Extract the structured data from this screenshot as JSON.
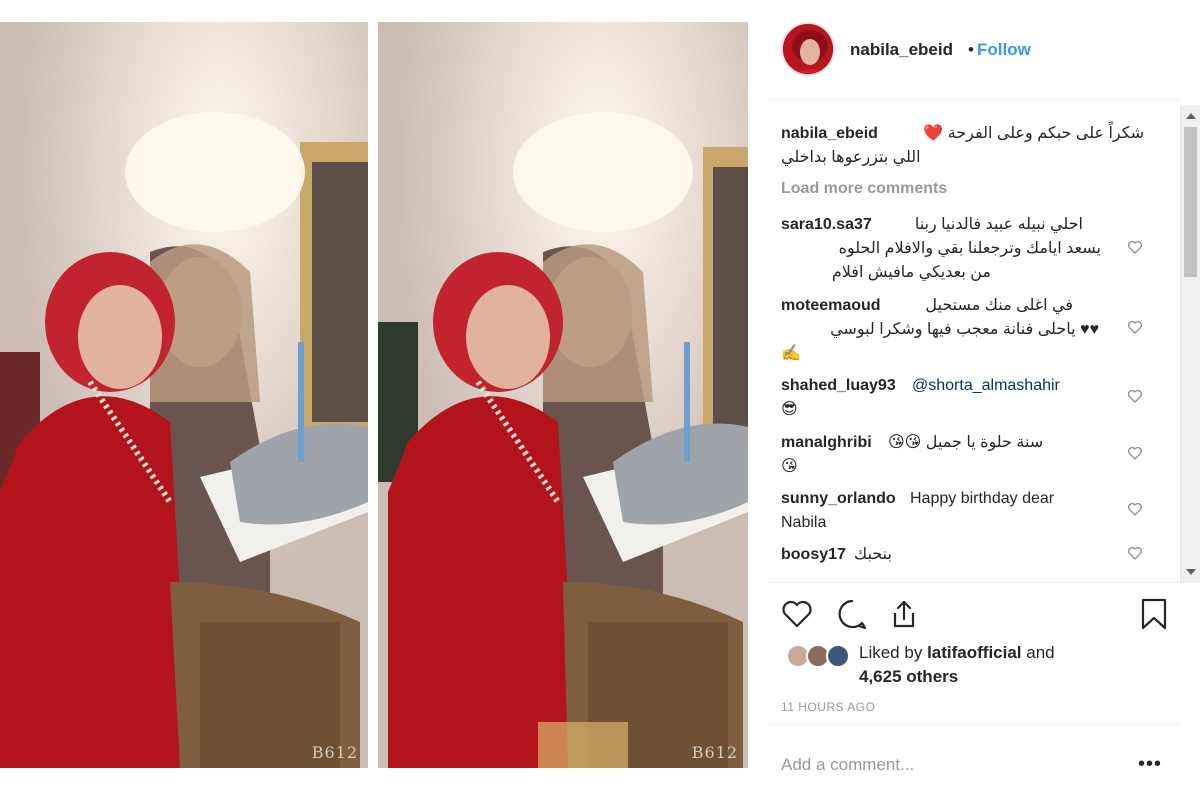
{
  "post": {
    "username": "nabila_ebeid",
    "separator": "•",
    "follow_label": "Follow",
    "watermark_left": "B612",
    "watermark_right": "B612"
  },
  "caption": {
    "username": "nabila_ebeid",
    "text_line1": "شكراً على حبكم وعلى الفرحة ❤️",
    "text_line2": "اللي بتزرعوها بداخلي"
  },
  "load_more": "Load more comments",
  "comments": [
    {
      "user": "sara10.sa37",
      "lines": [
        "احلي نبيله عبيد فالدنيا ربنا",
        "يسعد ايامك وترجعلنا بقي والافلام الحلوه",
        "من بعديكي مافيش افلام"
      ]
    },
    {
      "user": "moteemaoud",
      "lines": [
        "في اغلى منك مستحيل",
        "♥♥ ياحلى فنانة معجب فيها وشكرا لبوسي",
        "✍️"
      ]
    },
    {
      "user": "shahed_luay93",
      "mention": "@shorta_almashahir",
      "lines": [
        "😎"
      ]
    },
    {
      "user": "manalghribi",
      "lines": [
        "سنة حلوة يا جميل 😘😘",
        "😘"
      ]
    },
    {
      "user": "sunny_orlando",
      "lines": [
        "Happy birthday dear",
        "Nabila"
      ]
    },
    {
      "user": "boosy17",
      "lines": [
        "بنحبك"
      ]
    }
  ],
  "likes": {
    "prefix": "Liked by",
    "user": "latifaofficial",
    "suffix": "and",
    "others": "4,625 others"
  },
  "timestamp": "11 HOURS AGO",
  "add_comment_placeholder": "Add a comment...",
  "more_glyph": "•••",
  "icons": {
    "like": "heart-icon",
    "comment": "comment-icon",
    "share": "share-icon",
    "save": "bookmark-icon"
  },
  "colors": {
    "link": "#3897f0",
    "text": "#262626",
    "muted": "#999999",
    "border": "#efefef"
  }
}
